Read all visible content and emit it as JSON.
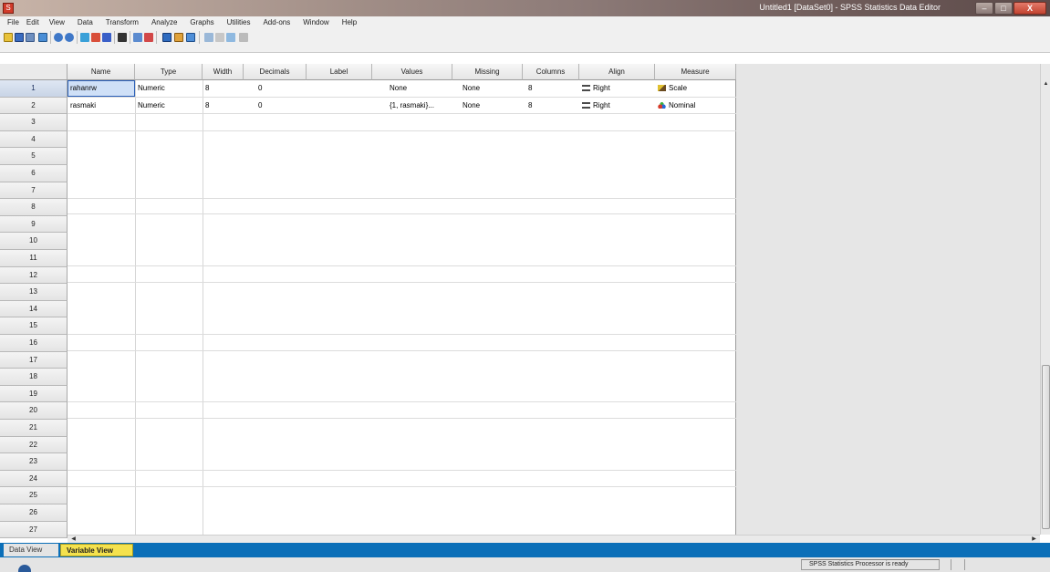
{
  "window": {
    "title": "Untitled1 [DataSet0] - SPSS Statistics Data Editor",
    "controls": {
      "minimize": "–",
      "maximize": "□",
      "close": "X"
    }
  },
  "menu": [
    "File",
    "Edit",
    "View",
    "Data",
    "Transform",
    "Analyze",
    "Graphs",
    "Utilities",
    "Add-ons",
    "Window",
    "Help"
  ],
  "grid": {
    "columns": [
      "Name",
      "Type",
      "Width",
      "Decimals",
      "Label",
      "Values",
      "Missing",
      "Columns",
      "Align",
      "Measure"
    ],
    "rows": [
      {
        "num": "1",
        "name": "rahanrw",
        "type": "Numeric",
        "width": "8",
        "decimals": "0",
        "label": "",
        "values": "None",
        "missing": "None",
        "columns": "8",
        "align": "Right",
        "measure": "Scale"
      },
      {
        "num": "2",
        "name": "rasmaki",
        "type": "Numeric",
        "width": "8",
        "decimals": "0",
        "label": "",
        "values": "{1, rasmaki}...",
        "missing": "None",
        "columns": "8",
        "align": "Right",
        "measure": "Nominal"
      }
    ],
    "row_numbers": [
      "1",
      "2",
      "3",
      "4",
      "5",
      "6",
      "7",
      "8",
      "9",
      "10",
      "11",
      "12",
      "13",
      "14",
      "15",
      "16",
      "17",
      "18",
      "19",
      "20",
      "21",
      "22",
      "23",
      "24",
      "25",
      "26",
      "27"
    ]
  },
  "tabs": {
    "data_view": "Data View",
    "variable_view": "Variable View"
  },
  "status": {
    "processor": "SPSS Statistics Processor is ready"
  },
  "colors": {
    "tab_bar": "#0b6fb8",
    "active_tab": "#f4e24d",
    "selected_cell": "#cfe0f7"
  },
  "icons": {
    "align_right": "align-right-icon",
    "scale": "ruler-pencil-icon",
    "nominal": "three-circles-icon"
  }
}
